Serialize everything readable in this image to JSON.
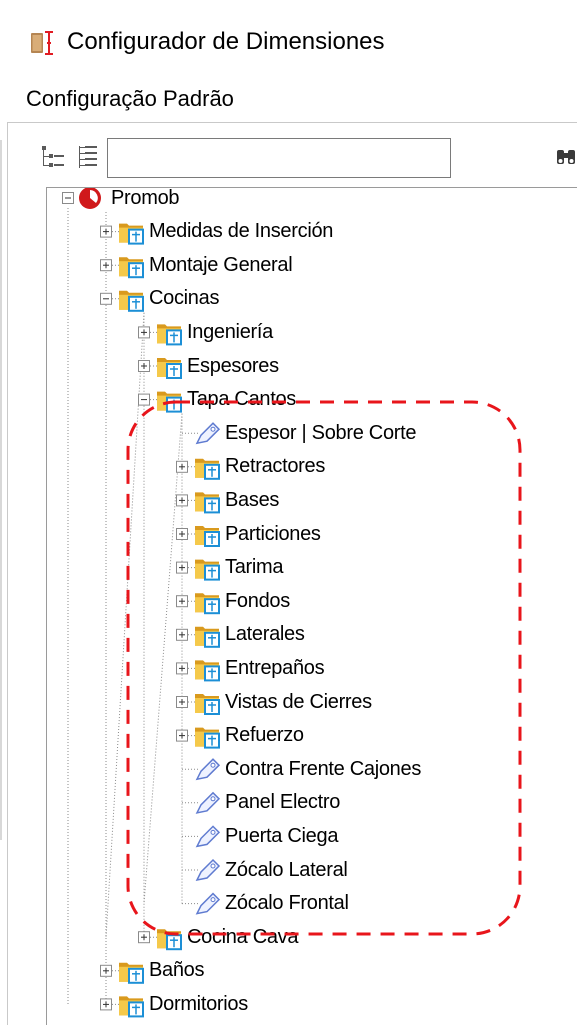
{
  "window": {
    "title": "Configurador de Dimensiones",
    "configuration_label": "Configuração Padrão"
  },
  "toolbar": {
    "search_value": "",
    "search_placeholder": ""
  },
  "tree": {
    "root": {
      "label": "Promob",
      "expanded": true
    },
    "nodes": [
      {
        "label": "Medidas de Inserción",
        "level": 1,
        "type": "folder",
        "expanded": false
      },
      {
        "label": "Montaje General",
        "level": 1,
        "type": "folder",
        "expanded": false
      },
      {
        "label": "Cocinas",
        "level": 1,
        "type": "folder",
        "expanded": true
      },
      {
        "label": "Ingeniería",
        "level": 2,
        "type": "folder",
        "expanded": false
      },
      {
        "label": "Espesores",
        "level": 2,
        "type": "folder",
        "expanded": false
      },
      {
        "label": "Tapa Cantos",
        "level": 2,
        "type": "folder",
        "expanded": true
      },
      {
        "label": "Espesor | Sobre Corte",
        "level": 3,
        "type": "tag"
      },
      {
        "label": "Retractores",
        "level": 3,
        "type": "folder",
        "expanded": false
      },
      {
        "label": "Bases",
        "level": 3,
        "type": "folder",
        "expanded": false
      },
      {
        "label": "Particiones",
        "level": 3,
        "type": "folder",
        "expanded": false
      },
      {
        "label": "Tarima",
        "level": 3,
        "type": "folder",
        "expanded": false
      },
      {
        "label": "Fondos",
        "level": 3,
        "type": "folder",
        "expanded": false
      },
      {
        "label": "Laterales",
        "level": 3,
        "type": "folder",
        "expanded": false
      },
      {
        "label": "Entrepaños",
        "level": 3,
        "type": "folder",
        "expanded": false
      },
      {
        "label": "Vistas de Cierres",
        "level": 3,
        "type": "folder",
        "expanded": false
      },
      {
        "label": "Refuerzo",
        "level": 3,
        "type": "folder",
        "expanded": false
      },
      {
        "label": "Contra Frente Cajones",
        "level": 3,
        "type": "tag"
      },
      {
        "label": "Panel Electro",
        "level": 3,
        "type": "tag"
      },
      {
        "label": "Puerta Ciega",
        "level": 3,
        "type": "tag"
      },
      {
        "label": "Zócalo Lateral",
        "level": 3,
        "type": "tag"
      },
      {
        "label": "Zócalo Frontal",
        "level": 3,
        "type": "tag"
      },
      {
        "label": "Cocina Cava",
        "level": 2,
        "type": "folder",
        "expanded": false
      },
      {
        "label": "Baños",
        "level": 1,
        "type": "folder",
        "expanded": false
      },
      {
        "label": "Dormitorios",
        "level": 1,
        "type": "folder",
        "expanded": false
      }
    ]
  },
  "annotation": {
    "style": "dashed-rounded-rect",
    "color": "#e8151b"
  },
  "colors": {
    "root_icon": "#d0191b",
    "folder": "#f5c94a",
    "folder_dark": "#d99a1e",
    "doc_blue": "#1c8fd6",
    "tag": "#5f7bd0"
  }
}
